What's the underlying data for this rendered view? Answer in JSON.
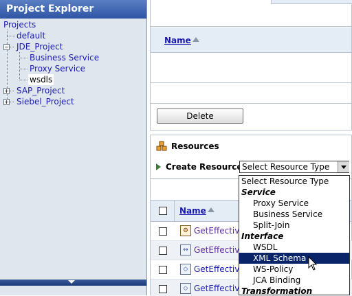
{
  "explorer": {
    "title": "Project Explorer",
    "tree": {
      "root": "Projects",
      "default": "default",
      "jde": "JDE_Project",
      "jde_children": [
        "Business Service",
        "Proxy Service",
        "wsdls"
      ],
      "sap": "SAP_Project",
      "siebel": "Siebel_Project"
    }
  },
  "top_panel": {
    "name_header": "Name",
    "delete_label": "Delete"
  },
  "resources": {
    "title": "Resources",
    "create_label": "Create Resource:",
    "select_value": "Select Resource Type",
    "name_header": "Name",
    "rows": [
      "GetEffective",
      "GetEffective",
      "GetEffective",
      "GetEffective"
    ]
  },
  "dropdown": {
    "options": [
      {
        "label": "Select Resource Type",
        "kind": "top"
      },
      {
        "label": "Service",
        "kind": "group"
      },
      {
        "label": "Proxy Service",
        "kind": "item"
      },
      {
        "label": "Business Service",
        "kind": "item"
      },
      {
        "label": "Split-Join",
        "kind": "item"
      },
      {
        "label": "Interface",
        "kind": "group"
      },
      {
        "label": "WSDL",
        "kind": "item"
      },
      {
        "label": "XML Schema",
        "kind": "item",
        "highlighted": true
      },
      {
        "label": "WS-Policy",
        "kind": "item"
      },
      {
        "label": "JCA Binding",
        "kind": "item"
      },
      {
        "label": "Transformation",
        "kind": "group"
      }
    ]
  },
  "colors": {
    "title_bar": "#2f55a4",
    "link": "#1a1ab0",
    "highlight": "#0a246a"
  }
}
